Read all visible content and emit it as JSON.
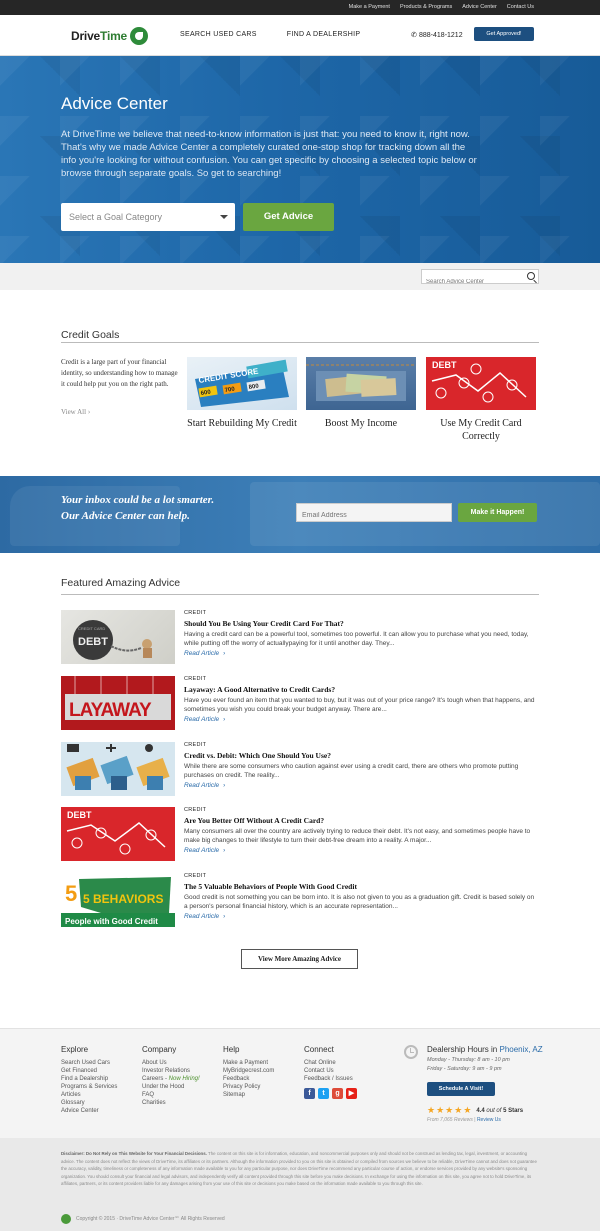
{
  "utility_links": [
    "Make a Payment",
    "Products & Programs",
    "Advice Center",
    "Contact Us"
  ],
  "header": {
    "logo_drive": "Drive",
    "logo_time": "Time",
    "nav": [
      "SEARCH USED CARS",
      "FIND A DEALERSHIP"
    ],
    "phone": "888-418-1212",
    "cta": "Get Approved!"
  },
  "hero": {
    "title": "Advice Center",
    "text": "At DriveTime we believe that need-to-know information is just that: you need to know it, right now. That's why we made Advice Center a completely curated one-stop shop for tracking down all the info you're looking for without confusion. You can get specific by choosing a selected topic below or browse through separate goals. So get to searching!",
    "select_placeholder": "Select a Goal Category",
    "button": "Get Advice"
  },
  "search": {
    "placeholder": "Search Advice Center"
  },
  "credit_goals": {
    "title": "Credit Goals",
    "intro": "Credit is a large part of your financial identity, so understanding how to manage it could help put you on the right path.",
    "view_all": "View All",
    "cards": [
      {
        "label": "Start Rebuilding My Credit",
        "image_text": "CREDIT SCORE",
        "image_numbers": [
          "600",
          "700",
          "800"
        ]
      },
      {
        "label": "Boost My Income"
      },
      {
        "label": "Use My Credit Card Correctly",
        "image_text": "DEBT"
      }
    ]
  },
  "newsletter": {
    "text": "Your inbox could be a lot smarter. Our Advice Center can help.",
    "placeholder": "Email Address",
    "button": "Make it Happen!"
  },
  "featured": {
    "title": "Featured Amazing Advice",
    "read_label": "Read Article",
    "items": [
      {
        "category": "CREDIT",
        "title": "Should You Be Using Your Credit Card For That?",
        "desc": "Having a credit card can be a powerful tool, sometimes too powerful. It can allow you to purchase what you need, today, while putting off the worry of actuallypaying for it until another day. They...",
        "image_text": "DEBT",
        "image_subtext": "CREDIT CARD"
      },
      {
        "category": "CREDIT",
        "title": "Layaway: A Good Alternative to Credit Cards?",
        "desc": "Have you ever found an item that you wanted to buy, but it was out of your price range? It's tough when that happens, and sometimes you wish you could break your budget anyway. There are...",
        "image_text": "LAYAWAY"
      },
      {
        "category": "CREDIT",
        "title": "Credit vs. Debit: Which One Should You Use?",
        "desc": "While there are some consumers who caution against ever using a credit card, there are others who promote putting purchases on credit. The reality..."
      },
      {
        "category": "CREDIT",
        "title": "Are You Better Off Without A Credit Card?",
        "desc": "Many consumers all over the country are actively trying to reduce their debt. It's not easy, and sometimes people have to make big changes to their lifestyle to turn their debt-free dream into a reality. A major...",
        "image_text": "DEBT"
      },
      {
        "category": "CREDIT",
        "title": "The 5 Valuable Behaviors of People With Good Credit",
        "desc": "Good credit is not something you can be born into. It is also not given to you as a graduation gift.  Credit is based solely on a person's personal financial history, which is an accurate representation...",
        "image_text": "5 BEHAVIORS",
        "image_subtext": "People with Good Credit"
      }
    ],
    "view_more": "View More Amazing Advice"
  },
  "footer": {
    "columns": [
      {
        "title": "Explore",
        "links": [
          "Search Used Cars",
          "Get Financed",
          "Find a Dealership",
          "Programs & Services",
          "Articles",
          "Glossary",
          "Advice Center"
        ]
      },
      {
        "title": "Company",
        "links": [
          "About Us",
          "Investor Relations",
          "Careers - Now Hiring!",
          "Under the Hood",
          "FAQ",
          "Charities"
        ]
      },
      {
        "title": "Help",
        "links": [
          "Make a Payment",
          "MyBridgecrest.com",
          "Feedback",
          "Privacy Policy",
          "Sitemap"
        ]
      },
      {
        "title": "Connect",
        "links": [
          "Chat Online",
          "Contact Us",
          "Feedback / Issues"
        ]
      }
    ],
    "hours_title": "Dealership Hours in",
    "hours_city": "Phoenix, AZ",
    "hours_lines": [
      "Monday - Thursday: 8 am - 10 pm",
      "Friday - Saturday: 9 am - 9 pm"
    ],
    "visit_button": "Schedule A Visit!",
    "rating": "4.4",
    "rating_out_of": "out of",
    "rating_max": "5 Stars",
    "reviews_count": "From 7,065 Reviews",
    "review_link": "Review Us",
    "disclaimer_bold": "Disclaimer: Do Not Rely on This Website for Your Financial Decisions.",
    "disclaimer": "The content on this site is for information, education, and noncommercial purposes only and should not be construed as lending tax, legal, investment, or accounting advice. The content does not reflect the views of DriveTime, its affiliates or its partners. Although the information provided to you on this site is obtained or compiled from sources we believe to be reliable, DriveTime cannot and does not guarantee the accuracy, validity, timeliness or completeness of any information made available to you for any particular purpose, nor does DriveTime recommend any particular course of action, or endorse services provided by any website's sponsoring organization. You should consult your financial and legal advisors, and independently verify all content provided through this site before you make decisions. In exchange for using the information on this site, you agree not to hold DriveTime, its affiliates, partners, or its content providers liable for any damages arising from your use of this site or decisions you make based on the information made available to you through this site.",
    "copyright": "Copyright © 2015 · DriveTime Advice Center℠ All Rights Reserved"
  },
  "colors": {
    "brand_blue": "#1d4f80",
    "accent_green": "#6aa640",
    "hero_blue": "#1e67a8"
  }
}
